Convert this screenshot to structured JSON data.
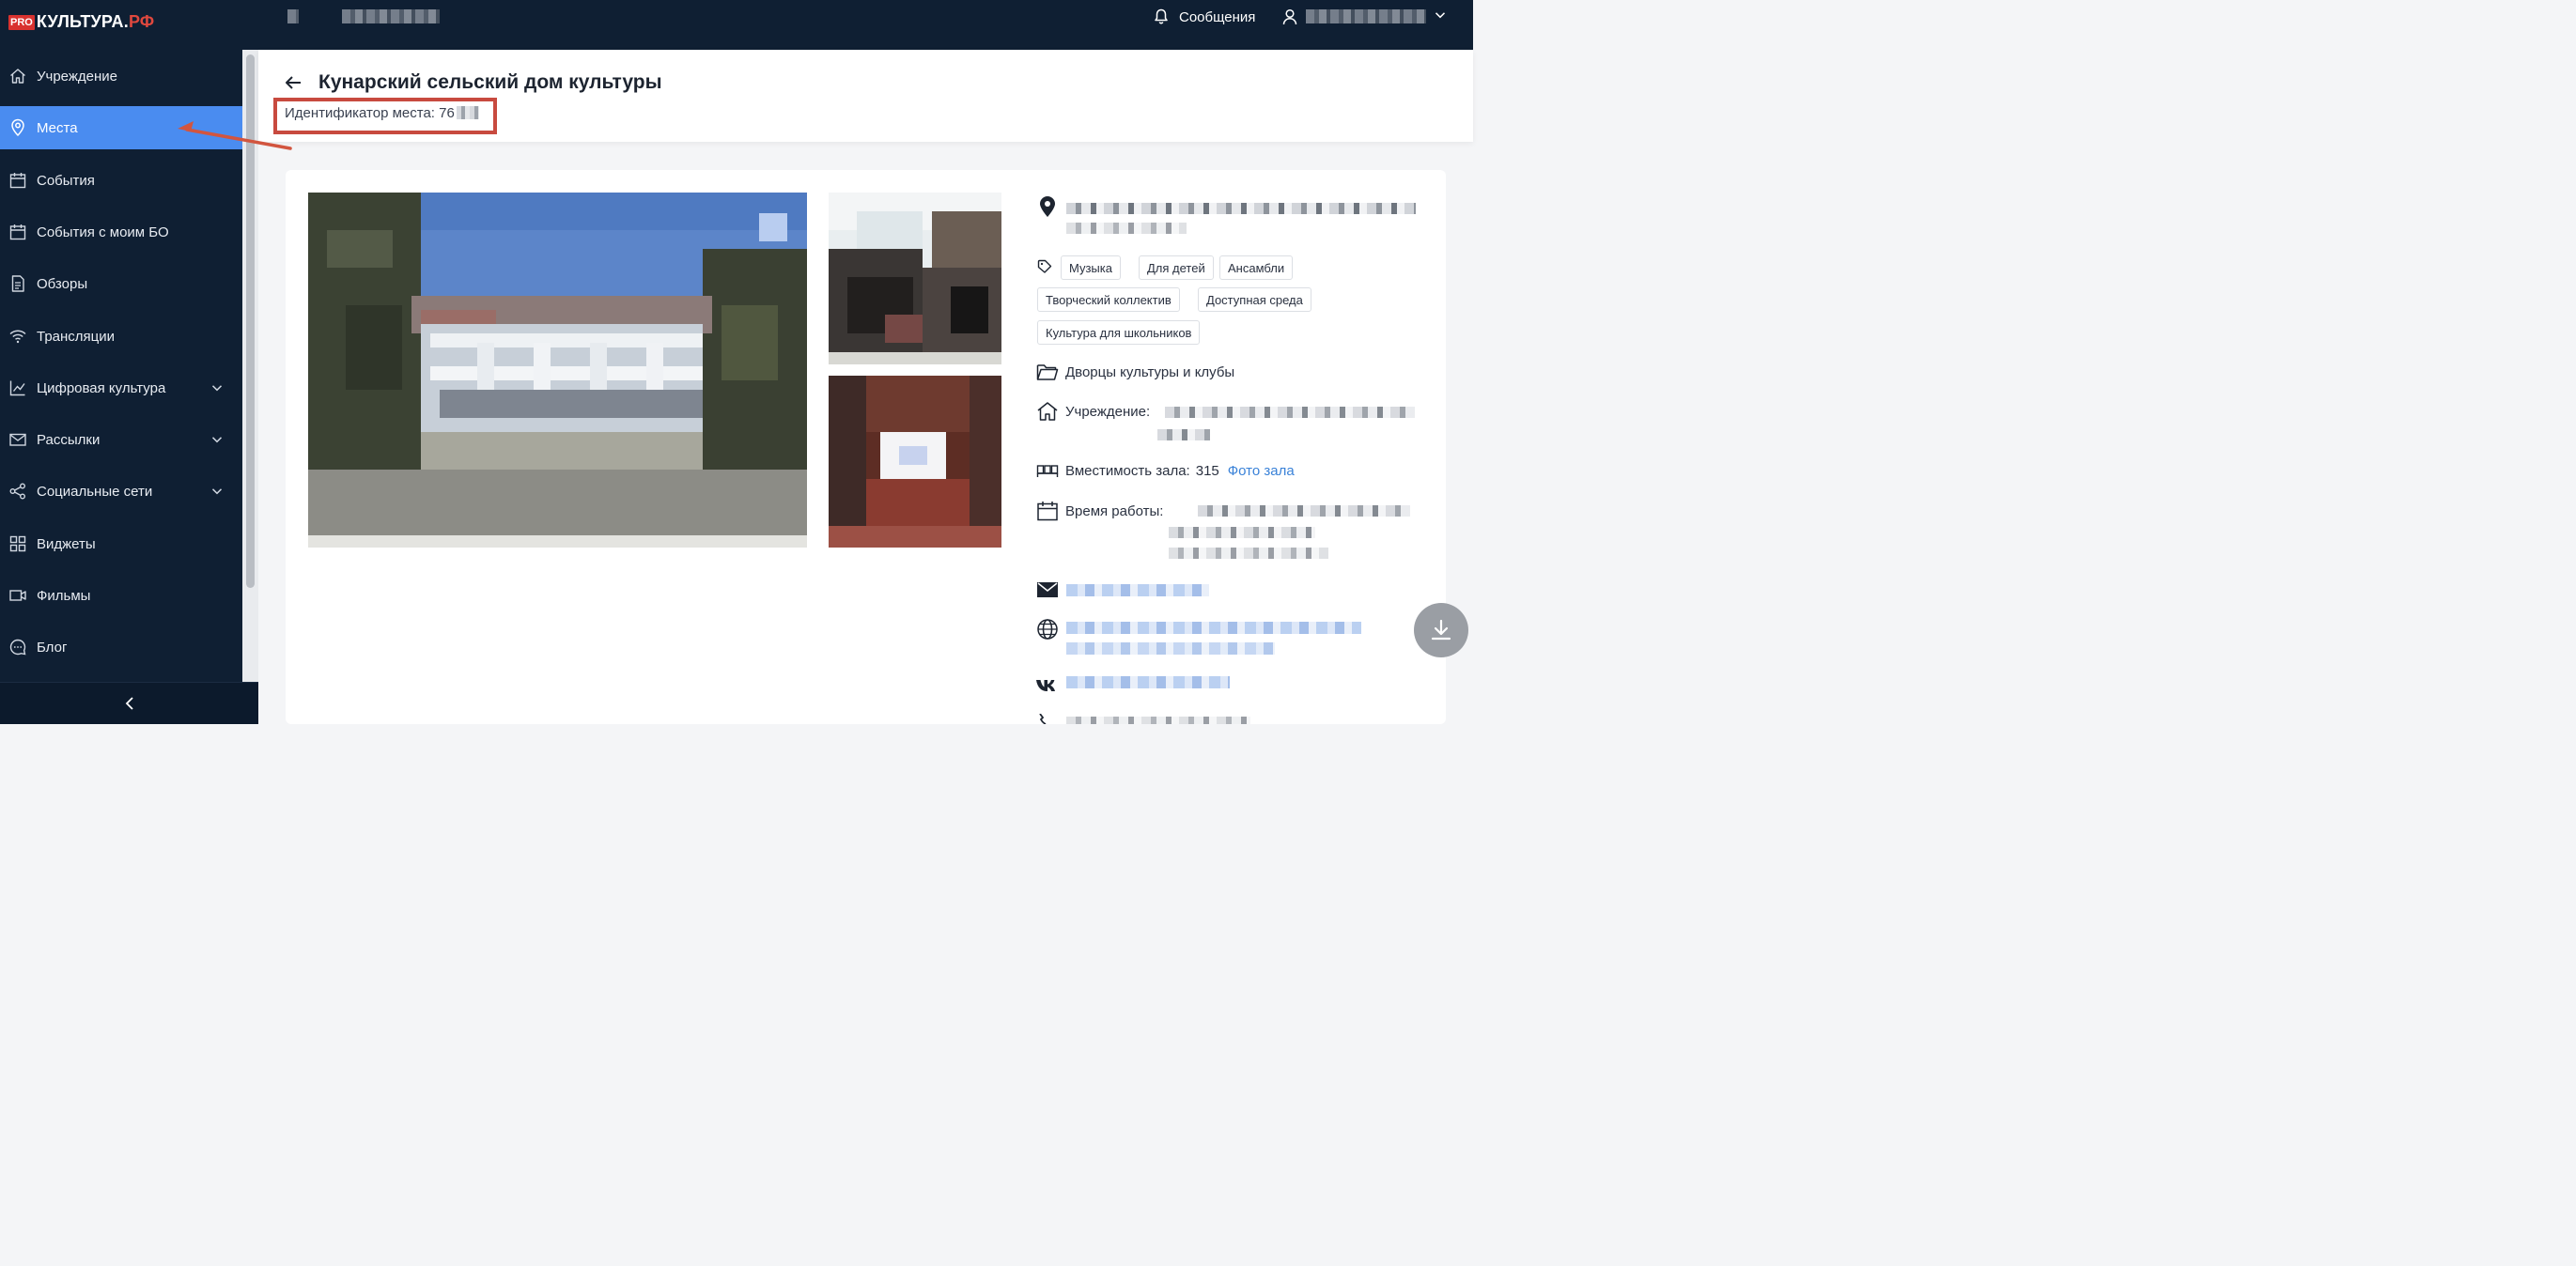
{
  "logo": {
    "pro": "PRO",
    "main": "КУЛЬТУРА.",
    "rf": "РФ"
  },
  "header": {
    "messages_label": "Сообщения"
  },
  "sidebar": {
    "items": [
      {
        "label": "Учреждение",
        "icon": "home-icon"
      },
      {
        "label": "Места",
        "icon": "location-pin-icon",
        "active": true
      },
      {
        "label": "События",
        "icon": "calendar-icon"
      },
      {
        "label": "События с моим БО",
        "icon": "calendar-icon"
      },
      {
        "label": "Обзоры",
        "icon": "document-icon"
      },
      {
        "label": "Трансляции",
        "icon": "wifi-icon"
      },
      {
        "label": "Цифровая культура",
        "icon": "chart-line-icon",
        "expandable": true
      },
      {
        "label": "Рассылки",
        "icon": "mail-icon",
        "expandable": true
      },
      {
        "label": "Социальные сети",
        "icon": "share-icon",
        "expandable": true
      },
      {
        "label": "Виджеты",
        "icon": "grid-icon"
      },
      {
        "label": "Фильмы",
        "icon": "video-camera-icon"
      },
      {
        "label": "Блог",
        "icon": "chat-bubble-icon"
      }
    ],
    "collapse_glyph": "<"
  },
  "page": {
    "title": "Кунарский сельский дом культуры",
    "id_label": "Идентификатор места: 76"
  },
  "tags": [
    "Музыка",
    "Для детей",
    "Ансамбли",
    "Творческий коллектив",
    "Доступная среда",
    "Культура для школьников"
  ],
  "info": {
    "category": "Дворцы культуры и клубы",
    "institution_label": "Учреждение:",
    "capacity_label": "Вместимость зала:",
    "capacity_value": "315",
    "hall_photo_link": "Фото зала",
    "hours_label": "Время работы:"
  },
  "colors": {
    "accent": "#4a8cf0",
    "sidebar_bg": "#0f1f33",
    "annotation": "#c84a3f",
    "link": "#3a82d8"
  }
}
